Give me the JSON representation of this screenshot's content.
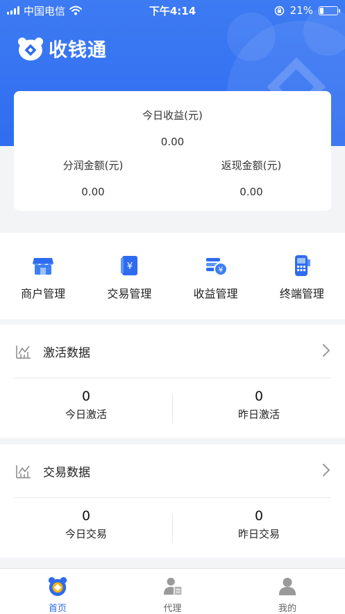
{
  "status_bar": {
    "carrier": "中国电信",
    "time": "下午4:14",
    "battery": "21%",
    "battery_level": 0.21
  },
  "brand": {
    "title": "收钱通"
  },
  "earnings": {
    "today_label": "今日收益(元)",
    "today_value": "0.00",
    "share_label": "分润金额(元)",
    "share_value": "0.00",
    "cashback_label": "返现金额(元)",
    "cashback_value": "0.00"
  },
  "menu": {
    "items": [
      {
        "label": "商户管理",
        "icon": "store-icon"
      },
      {
        "label": "交易管理",
        "icon": "yuan-document-icon"
      },
      {
        "label": "收益管理",
        "icon": "coins-stack-icon"
      },
      {
        "label": "终端管理",
        "icon": "pos-terminal-icon"
      }
    ]
  },
  "activation": {
    "title": "激活数据",
    "today_value": "0",
    "today_label": "今日激活",
    "yesterday_value": "0",
    "yesterday_label": "昨日激活"
  },
  "transaction": {
    "title": "交易数据",
    "today_value": "0",
    "today_label": "今日交易",
    "yesterday_value": "0",
    "yesterday_label": "昨日交易"
  },
  "tabbar": {
    "items": [
      {
        "label": "首页",
        "icon": "home-bear-icon",
        "active": true
      },
      {
        "label": "代理",
        "icon": "agent-icon",
        "active": false
      },
      {
        "label": "我的",
        "icon": "user-icon",
        "active": false
      }
    ]
  },
  "colors": {
    "primary": "#2e6bf0",
    "background": "#f3f4f6"
  }
}
